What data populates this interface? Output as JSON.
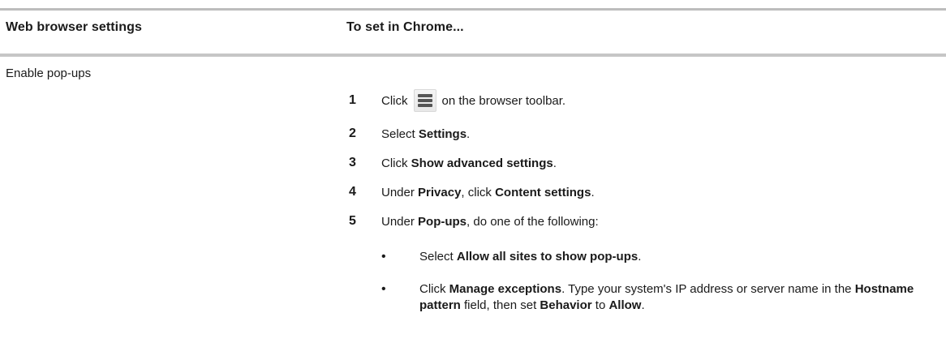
{
  "header": {
    "col1": "Web browser settings",
    "col2": "To set in Chrome..."
  },
  "row": {
    "setting": "Enable pop-ups",
    "steps": [
      {
        "num": "1",
        "pre": "Click",
        "icon": "menu-icon",
        "post": "on the browser toolbar."
      },
      {
        "num": "2",
        "pre": "Select ",
        "bold1": "Settings",
        "post": "."
      },
      {
        "num": "3",
        "pre": "Click ",
        "bold1": "Show advanced settings",
        "post": "."
      },
      {
        "num": "4",
        "pre": "Under ",
        "bold1": "Privacy",
        "mid": ", click ",
        "bold2": "Content settings",
        "post": "."
      },
      {
        "num": "5",
        "pre": "Under ",
        "bold1": "Pop-ups",
        "post": ", do one of the following:"
      }
    ],
    "bullets": [
      {
        "pre": "Select ",
        "bold1": "Allow all sites to show pop-ups",
        "post": "."
      },
      {
        "pre": "Click ",
        "bold1": "Manage exceptions",
        "mid1": ". Type your system's IP address or server name in the ",
        "bold2": "Hostname pattern",
        "mid2": " field, then set ",
        "bold3": "Behavior",
        "mid3": " to ",
        "bold4": "Allow",
        "post": "."
      }
    ]
  }
}
